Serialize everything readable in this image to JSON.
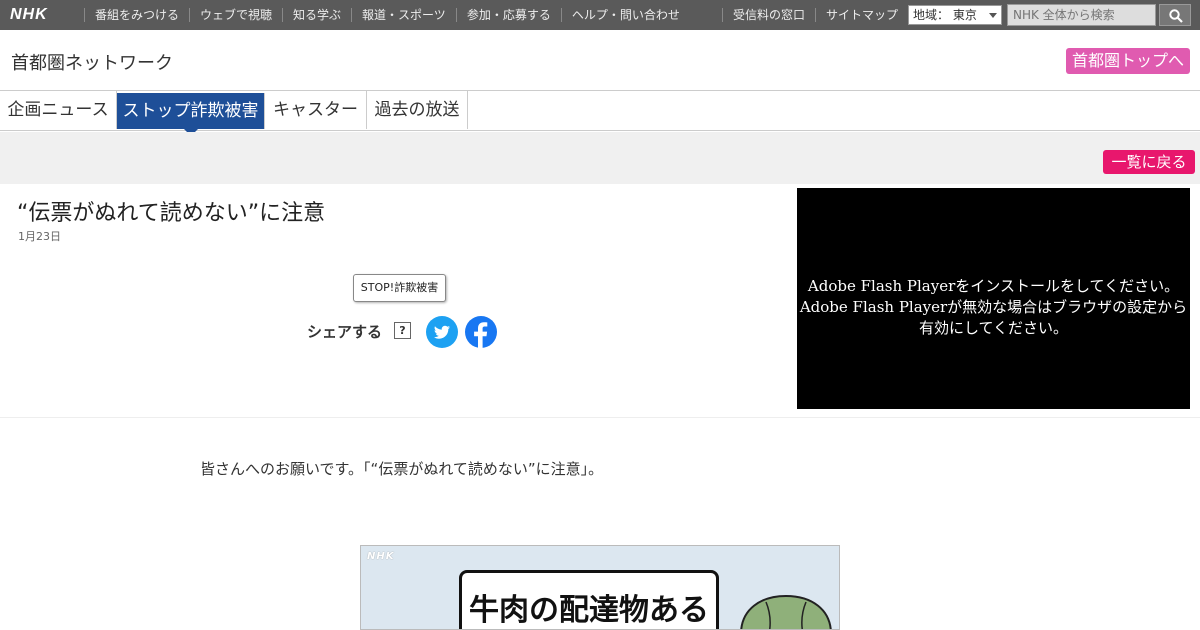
{
  "topbar": {
    "logo": "NHK",
    "nav": [
      "番組をみつける",
      "ウェブで視聴",
      "知る学ぶ",
      "報道・スポーツ",
      "参加・応募する",
      "ヘルプ・問い合わせ"
    ],
    "nav2": [
      "受信料の窓口",
      "サイトマップ"
    ],
    "region": "地域： 東京",
    "search_placeholder": "NHK 全体から検索"
  },
  "header": {
    "title": "首都圏ネットワーク",
    "top_link": "首都圏トップへ"
  },
  "tabs": [
    {
      "label": "企画ニュース",
      "active": false
    },
    {
      "label": "ストップ詐欺被害",
      "active": true
    },
    {
      "label": "キャスター",
      "active": false
    },
    {
      "label": "過去の放送",
      "active": false
    }
  ],
  "back_label": "一覧に戻る",
  "article": {
    "title": "“伝票がぬれて読めない”に注意",
    "date": "1月23日",
    "tag": "STOP!詐欺被害",
    "share_label": "シェアする",
    "share_help": "?"
  },
  "video": {
    "line1": "Adobe Flash Playerをインストールをしてください。",
    "line2": "Adobe Flash Playerが無効な場合はブラウザの設定から",
    "line3": "有効にしてください。"
  },
  "body": {
    "text": "皆さんへのお願いです。「“伝票がぬれて読めない”に注意」。",
    "figure_watermark": "NHK",
    "figure_caption": "牛肉の配達物ある"
  }
}
